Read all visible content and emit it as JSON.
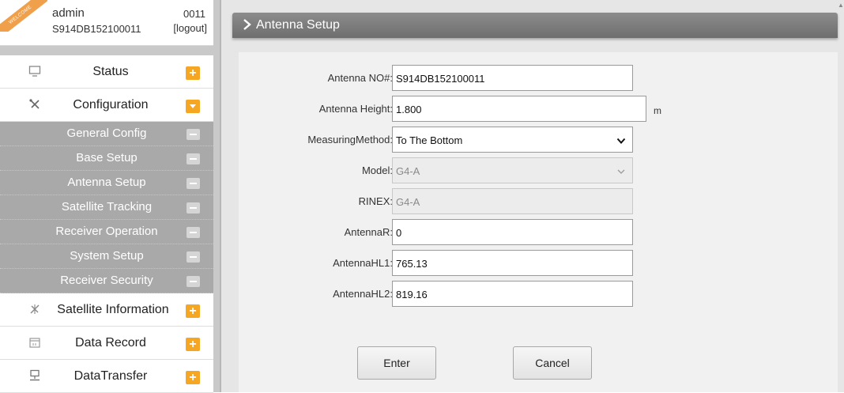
{
  "user": {
    "ribbon_text": "WELCOME",
    "name": "admin",
    "serial": "S914DB152100011",
    "code": "0011",
    "logout_label": "[logout]"
  },
  "menu": {
    "status": {
      "label": "Status",
      "icon": "monitor-icon",
      "toggle": "+"
    },
    "configuration": {
      "label": "Configuration",
      "icon": "tools-icon",
      "toggle": "-"
    },
    "submenu": [
      {
        "label": "General Config"
      },
      {
        "label": "Base Setup"
      },
      {
        "label": "Antenna Setup"
      },
      {
        "label": "Satellite Tracking"
      },
      {
        "label": "Receiver Operation"
      },
      {
        "label": "System Setup"
      },
      {
        "label": "Receiver Security"
      }
    ],
    "satellite_info": {
      "label": "Satellite Information",
      "icon": "satellite-icon",
      "toggle": "+"
    },
    "data_record": {
      "label": "Data Record",
      "icon": "calendar-icon",
      "toggle": "+"
    },
    "data_transfer": {
      "label": "DataTransfer",
      "icon": "network-icon",
      "toggle": "+"
    }
  },
  "page": {
    "title": "Antenna Setup"
  },
  "form": {
    "antenna_no": {
      "label": "Antenna NO#:",
      "value": "S914DB152100011"
    },
    "antenna_height": {
      "label": "Antenna Height:",
      "value": "1.800",
      "unit": "m"
    },
    "measuring_method": {
      "label": "MeasuringMethod:",
      "value": "To The Bottom"
    },
    "model": {
      "label": "Model:",
      "value": "G4-A"
    },
    "rinex": {
      "label": "RINEX:",
      "value": "G4-A"
    },
    "antenna_r": {
      "label": "AntennaR:",
      "value": "0"
    },
    "antenna_hl1": {
      "label": "AntennaHL1:",
      "value": "765.13"
    },
    "antenna_hl2": {
      "label": "AntennaHL2:",
      "value": "819.16"
    }
  },
  "buttons": {
    "enter": "Enter",
    "cancel": "Cancel"
  },
  "colors": {
    "accent_orange": "#f5a623",
    "submenu_bg": "#a9a9a9",
    "header_bg": "#7d7d7d"
  }
}
